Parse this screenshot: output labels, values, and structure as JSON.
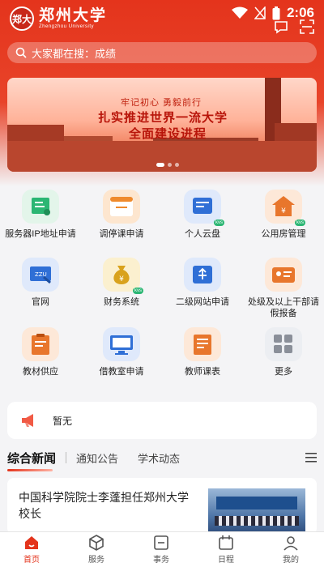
{
  "status_bar": {
    "time": "2:06"
  },
  "header": {
    "logo_cn": "郑州大学",
    "logo_en": "Zhengzhou University",
    "logo_seal": "郑大"
  },
  "search": {
    "prefix": "大家都在搜：",
    "keyword": "成绩"
  },
  "banner": {
    "slogan_small": "牢记初心 勇毅前行",
    "slogan_line1": "扎实推进世界一流大学",
    "slogan_line2": "全面建设进程",
    "pages": 3,
    "active_page": 1
  },
  "services": [
    {
      "label": "服务器IP地址申请",
      "icon": "certificate-icon",
      "color": "#2bb673",
      "bg": "#e3f5ea",
      "badge": ""
    },
    {
      "label": "调停课申请",
      "icon": "calendar-card-icon",
      "color": "#ef8a2c",
      "bg": "#fde6cf",
      "badge": ""
    },
    {
      "label": "个人云盘",
      "icon": "cloud-drive-icon",
      "color": "#2f6fd6",
      "bg": "#dfe9fb",
      "badge": "kvs"
    },
    {
      "label": "公用房管理",
      "icon": "house-icon",
      "color": "#e8762c",
      "bg": "#fde8d8",
      "badge": "kvs"
    },
    {
      "label": "官网",
      "icon": "website-icon",
      "color": "#2f6fd6",
      "bg": "#dfe9fb",
      "badge": ""
    },
    {
      "label": "财务系统",
      "icon": "money-bag-icon",
      "color": "#d9a21c",
      "bg": "#fbf0cf",
      "badge": "kvs"
    },
    {
      "label": "二级网站申请",
      "icon": "usb-icon",
      "color": "#2f6fd6",
      "bg": "#dfe9fb",
      "badge": ""
    },
    {
      "label": "处级及以上干部请假报备",
      "icon": "id-card-icon",
      "color": "#e8762c",
      "bg": "#fde8d8",
      "badge": ""
    },
    {
      "label": "教材供应",
      "icon": "clipboard-icon",
      "color": "#e8762c",
      "bg": "#fde8d8",
      "badge": ""
    },
    {
      "label": "借教室申请",
      "icon": "monitor-icon",
      "color": "#2f6fd6",
      "bg": "#dfe9fb",
      "badge": ""
    },
    {
      "label": "教师课表",
      "icon": "schedule-list-icon",
      "color": "#e8762c",
      "bg": "#fde8d8",
      "badge": ""
    },
    {
      "label": "更多",
      "icon": "grid-more-icon",
      "color": "#8a8f99",
      "bg": "#eceef2",
      "badge": ""
    }
  ],
  "notice": {
    "text": "暂无"
  },
  "news_tabs": [
    "综合新闻",
    "通知公告",
    "学术动态"
  ],
  "news": [
    {
      "title": "中国科学院院士李蓬担任郑州大学校长"
    }
  ],
  "tabbar": [
    {
      "label": "首页",
      "icon": "home-icon",
      "active": true
    },
    {
      "label": "服务",
      "icon": "cube-icon",
      "active": false
    },
    {
      "label": "事务",
      "icon": "task-icon",
      "active": false
    },
    {
      "label": "日程",
      "icon": "calendar-icon",
      "active": false
    },
    {
      "label": "我的",
      "icon": "user-icon",
      "active": false
    }
  ],
  "colors": {
    "brand": "#e4341c",
    "page_bg": "#f4f4f6"
  }
}
